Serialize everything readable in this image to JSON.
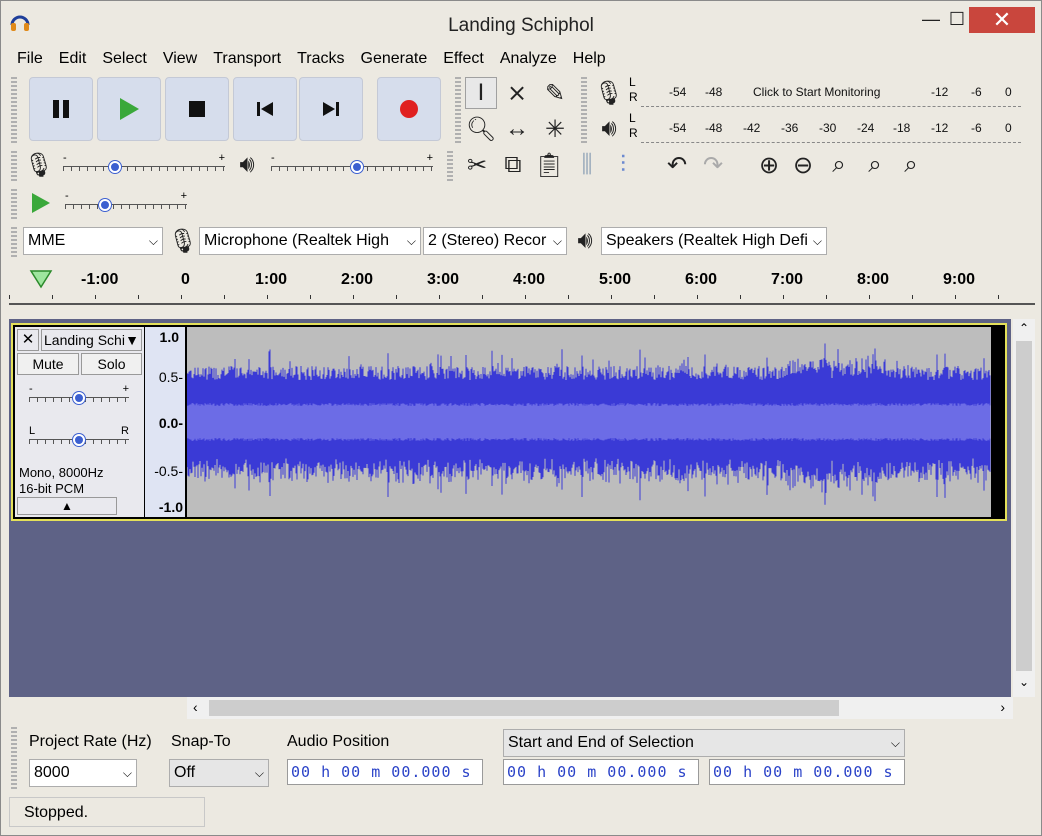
{
  "window": {
    "title": "Landing Schiphol",
    "minimize": "—",
    "maximize": "☐",
    "close": "✕"
  },
  "menu": [
    "File",
    "Edit",
    "Select",
    "View",
    "Transport",
    "Tracks",
    "Generate",
    "Effect",
    "Analyze",
    "Help"
  ],
  "meters": {
    "record": {
      "l": "L",
      "r": "R",
      "ticks": [
        "-54",
        "-48",
        "Click to Start Monitoring",
        "-12",
        "-6",
        "0"
      ]
    },
    "play": {
      "l": "L",
      "r": "R",
      "ticks": [
        "-54",
        "-48",
        "-42",
        "-36",
        "-30",
        "-24",
        "-18",
        "-12",
        "-6",
        "0"
      ]
    }
  },
  "slider_labels": {
    "minus": "-",
    "plus": "+"
  },
  "device": {
    "host": "MME",
    "mic": "Microphone (Realtek High",
    "channels": "2 (Stereo) Recor",
    "speakers": "Speakers (Realtek High Defi"
  },
  "ruler": [
    "-1:00",
    "0",
    "1:00",
    "2:00",
    "3:00",
    "4:00",
    "5:00",
    "6:00",
    "7:00",
    "8:00",
    "9:00"
  ],
  "track": {
    "name": "Landing Schi",
    "mute": "Mute",
    "solo": "Solo",
    "pan_l": "L",
    "pan_r": "R",
    "info1": "Mono, 8000Hz",
    "info2": "16-bit PCM",
    "scale": [
      "1.0",
      "0.5-",
      "0.0-",
      "-0.5-",
      "-1.0"
    ]
  },
  "selbar": {
    "rate_label": "Project Rate (Hz)",
    "rate_value": "8000",
    "snap_label": "Snap-To",
    "snap_value": "Off",
    "audio_pos_label": "Audio Position",
    "sel_label": "Start and End of Selection",
    "time1": "00 h 00 m 00.000 s",
    "time2": "00 h 00 m 00.000 s",
    "time3": "00 h 00 m 00.000 s"
  },
  "status": "Stopped.",
  "colors": {
    "wave": "#3a3ad6",
    "wave_rms": "#6c6ce6",
    "track_bg": "#5e6286",
    "record": "#e02020",
    "play": "#3aa83a"
  }
}
